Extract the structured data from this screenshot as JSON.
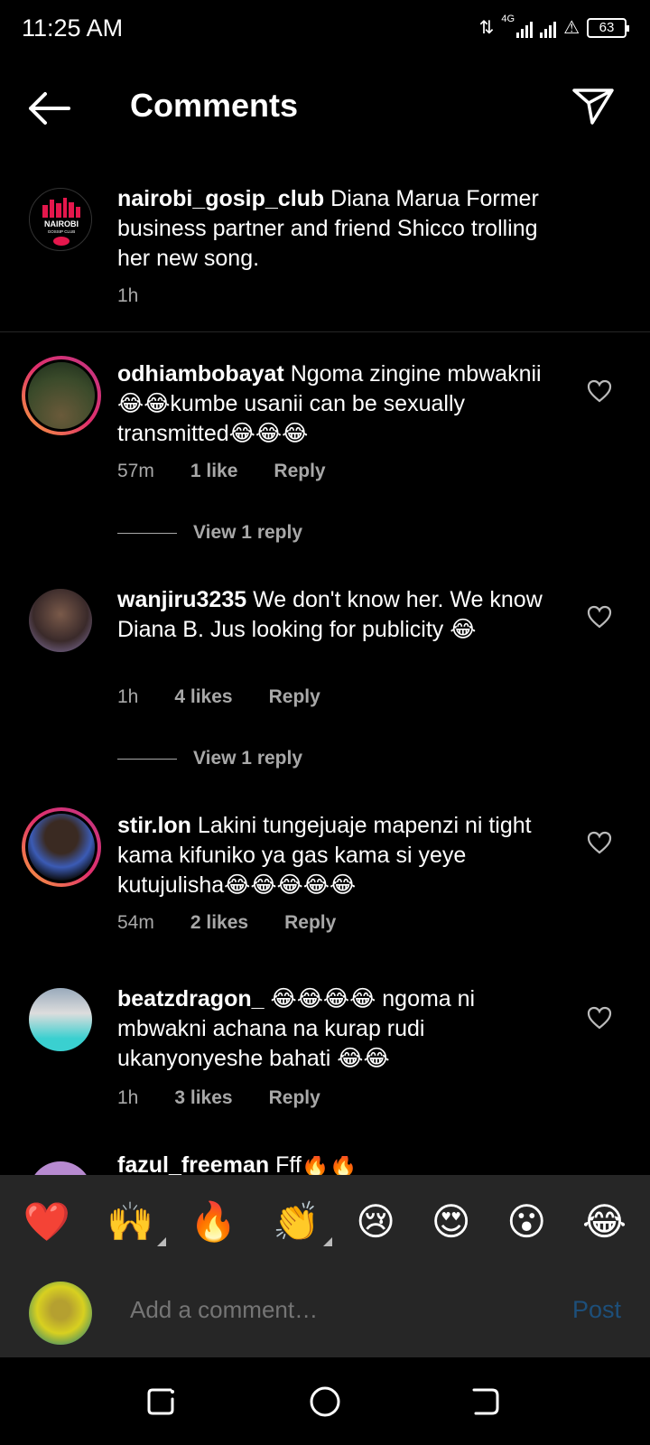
{
  "status": {
    "time": "11:25 AM",
    "network": "4G",
    "battery": "63"
  },
  "header": {
    "title": "Comments"
  },
  "caption": {
    "username": "nairobi_gosip_club",
    "text": " Diana Marua Former business partner and friend Shicco trolling her new song.",
    "time": "1h",
    "avatar_label": "NAIROBI",
    "avatar_sublabel": "GOSSIP CLUB"
  },
  "comments": [
    {
      "username": "odhiambobayat",
      "text": " Ngoma zingine mbwaknii 😂😂kumbe usanii can be sexually transmitted😂😂😂",
      "time": "57m",
      "likes": "1 like",
      "reply": "Reply",
      "view_replies": "View 1 reply"
    },
    {
      "username": "wanjiru3235",
      "text": " We don't know her. We know Diana B. Jus looking for publicity 😂",
      "time": "1h",
      "likes": "4 likes",
      "reply": "Reply",
      "view_replies": "View 1 reply"
    },
    {
      "username": "stir.lon",
      "text": " Lakini tungejuaje mapenzi ni tight kama kifuniko ya gas kama si yeye kutujulisha😂😂😂😂😂",
      "time": "54m",
      "likes": "2 likes",
      "reply": "Reply"
    },
    {
      "username": "beatzdragon_",
      "text": " 😂😂😂😂 ngoma ni mbwakni achana na kurap rudi ukanyonyeshe bahati 😂😂",
      "time": "1h",
      "likes": "3 likes",
      "reply": "Reply"
    },
    {
      "username": "fazul_freeman",
      "text": " Fff🔥🔥"
    }
  ],
  "emoji_bar": [
    "❤️",
    "🙌",
    "🔥",
    "👏",
    "😢",
    "😍",
    "😮",
    "😂"
  ],
  "comment_input": {
    "placeholder": "Add a comment…",
    "post_label": "Post"
  },
  "colors": {
    "background": "#000000",
    "panel": "#262626",
    "muted_text": "#a8a8a8",
    "post_disabled": "#1d4f7a"
  }
}
